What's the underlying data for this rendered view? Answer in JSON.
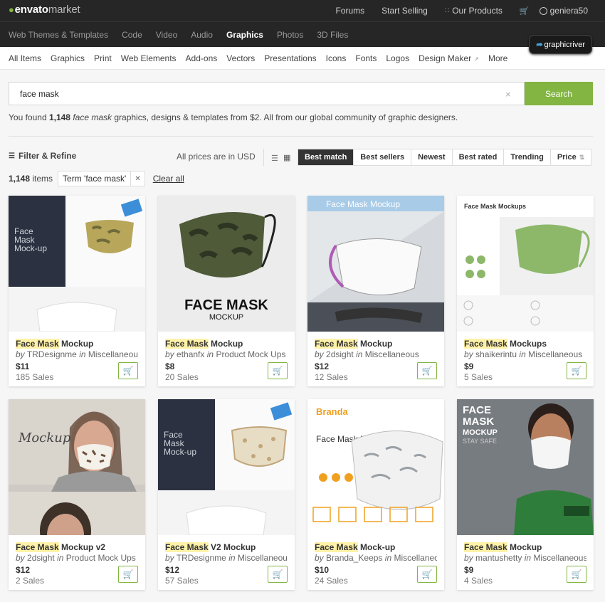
{
  "header": {
    "logo_brand": "envato",
    "logo_market": "market",
    "forums": "Forums",
    "start_selling": "Start Selling",
    "our_products": "Our Products",
    "username": "geniera50"
  },
  "categories": [
    "Web Themes & Templates",
    "Code",
    "Video",
    "Audio",
    "Graphics",
    "Photos",
    "3D Files"
  ],
  "active_category": "Graphics",
  "graphicriver_label": "graphicriver",
  "subcategories": [
    "All Items",
    "Graphics",
    "Print",
    "Web Elements",
    "Add-ons",
    "Vectors",
    "Presentations",
    "Icons",
    "Fonts",
    "Logos",
    "Design Maker",
    "More"
  ],
  "search": {
    "value": "face mask",
    "button": "Search"
  },
  "found": {
    "prefix": "You found ",
    "count": "1,148",
    "term": "face mask",
    "suffix": " graphics, designs & templates from $2. All from our global community of graphic designers."
  },
  "filter_label": "Filter & Refine",
  "prices_note": "All prices are in USD",
  "sort_options": [
    "Best match",
    "Best sellers",
    "Newest",
    "Best rated",
    "Trending",
    "Price"
  ],
  "active_sort": "Best match",
  "results_count": "1,148",
  "results_unit": "items",
  "term_chip": "Term 'face mask'",
  "clear_all": "Clear all",
  "thumb_text": {
    "mask_title": "FACE MASK",
    "mask_sub": "MOCKUP",
    "banner": "Face Mask Mockup",
    "branda": "Branda",
    "branda_title": "Face Mask Mock-up",
    "envato_title": "Face Mask Mock-up",
    "last_title_1": "FACE",
    "last_title_2": "MASK",
    "last_title_3": "MOCKUP",
    "last_title_4": "STAY SAFE",
    "mockups_title": "Face Mask Mockups",
    "script": "Mockup"
  },
  "items": [
    {
      "hl": "Face Mask",
      "rest": " Mockup",
      "by": "TRDesignme",
      "cat": "Miscellaneous",
      "price": "$11",
      "sales": "185 Sales"
    },
    {
      "hl": "Face Mask",
      "rest": " Mockup",
      "by": "ethanfx",
      "cat": "Product Mock Ups",
      "price": "$8",
      "sales": "20 Sales"
    },
    {
      "hl": "Face Mask",
      "rest": " Mockup",
      "by": "2dsight",
      "cat": "Miscellaneous",
      "price": "$12",
      "sales": "12 Sales"
    },
    {
      "hl": "Face Mask",
      "rest": " Mockups",
      "by": "shaikerintu",
      "cat": "Miscellaneous",
      "price": "$9",
      "sales": "5 Sales"
    },
    {
      "hl": "Face Mask",
      "rest": " Mockup v2",
      "by": "2dsight",
      "cat": "Product Mock Ups",
      "price": "$12",
      "sales": "2 Sales"
    },
    {
      "hl": "Face Mask",
      "rest": " V2 Mockup",
      "by": "TRDesignme",
      "cat": "Miscellaneous",
      "price": "$12",
      "sales": "57 Sales"
    },
    {
      "hl": "Face Mask",
      "rest": " Mock-up",
      "by": "Branda_Keeps",
      "cat": "Miscellaneous",
      "price": "$10",
      "sales": "24 Sales"
    },
    {
      "hl": "Face Mask",
      "rest": " Mockup",
      "by": "mantushetty",
      "cat": "Miscellaneous",
      "price": "$9",
      "sales": "4 Sales"
    }
  ],
  "by_word": "by",
  "in_word": "in",
  "colors": {
    "accent": "#82b541",
    "dark": "#262626"
  }
}
